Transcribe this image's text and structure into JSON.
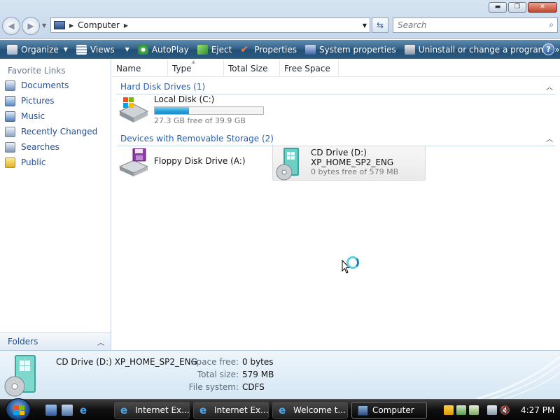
{
  "window": {
    "minimize_glyph": "▬",
    "maximize_glyph": "❐",
    "close_glyph": "✕"
  },
  "address_bar": {
    "location": "Computer",
    "search_placeholder": "Search"
  },
  "toolbar": {
    "items": [
      {
        "label": "Organize",
        "icon": "organize-icon",
        "dropdown": true
      },
      {
        "label": "Views",
        "icon": "views-icon",
        "dropdown": true
      },
      {
        "label": "AutoPlay",
        "icon": "autoplay-icon",
        "dropdown": false
      },
      {
        "label": "Eject",
        "icon": "eject-icon",
        "dropdown": false
      },
      {
        "label": "Properties",
        "icon": "properties-icon",
        "dropdown": false
      },
      {
        "label": "System properties",
        "icon": "system-properties-icon",
        "dropdown": false
      },
      {
        "label": "Uninstall or change a program",
        "icon": "uninstall-icon",
        "dropdown": false
      }
    ],
    "overflow": "»",
    "help": "?"
  },
  "left_pane": {
    "title": "Favorite Links",
    "items": [
      {
        "label": "Documents",
        "icon": "documents-icon"
      },
      {
        "label": "Pictures",
        "icon": "pictures-icon"
      },
      {
        "label": "Music",
        "icon": "music-icon"
      },
      {
        "label": "Recently Changed",
        "icon": "recently-changed-icon"
      },
      {
        "label": "Searches",
        "icon": "searches-icon"
      },
      {
        "label": "Public",
        "icon": "public-folder-icon"
      }
    ],
    "folders_label": "Folders"
  },
  "columns": [
    "Name",
    "Type",
    "Total Size",
    "Free Space"
  ],
  "groups": {
    "hard_disks": {
      "title": "Hard Disk Drives (1)",
      "drives": [
        {
          "name": "Local Disk (C:)",
          "free_text": "27.3 GB free of 39.9 GB",
          "used_fraction": 0.316,
          "icon": "hard-disk-icon"
        }
      ]
    },
    "removable": {
      "title": "Devices with Removable Storage (2)",
      "drives": [
        {
          "name": "Floppy Disk Drive (A:)",
          "icon": "floppy-drive-icon"
        },
        {
          "name": "CD Drive (D:)",
          "label": "XP_HOME_SP2_ENG",
          "free_text": "0 bytes free of 579 MB",
          "icon": "cd-drive-icon",
          "selected": true
        }
      ]
    }
  },
  "details": {
    "title": "CD Drive (D:) XP_HOME_SP2_ENG",
    "space_free_label": "Space free:",
    "space_free": "0 bytes",
    "total_size_label": "Total size:",
    "total_size": "579 MB",
    "file_system_label": "File system:",
    "file_system": "CDFS"
  },
  "taskbar": {
    "tasks": [
      {
        "label": "Internet Ex...",
        "icon": "internet-explorer-icon"
      },
      {
        "label": "Internet Ex...",
        "icon": "internet-explorer-icon"
      },
      {
        "label": "Welcome t...",
        "icon": "internet-explorer-icon"
      },
      {
        "label": "Computer",
        "icon": "computer-icon",
        "active": true
      }
    ],
    "clock": "4:27 PM"
  },
  "colors": {
    "link_blue": "#1f4fa3",
    "group_blue": "#1f5fb8",
    "toolbar_blue": "#2d5d85",
    "progress_fill": "#26a0da"
  }
}
